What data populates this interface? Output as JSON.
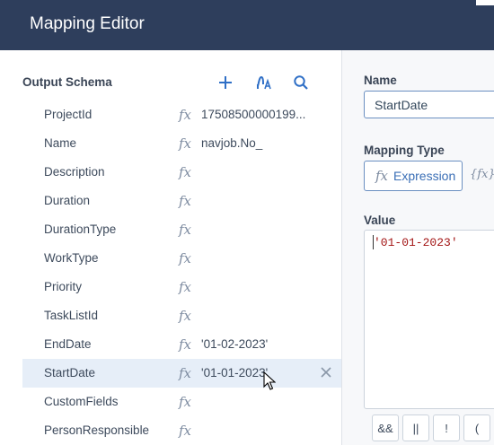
{
  "window": {
    "title": "Mapping Editor"
  },
  "left_panel": {
    "header": "Output Schema",
    "tools": [
      {
        "name": "add-icon",
        "label": "+"
      },
      {
        "name": "sort-icon"
      },
      {
        "name": "search-icon"
      }
    ],
    "rows": [
      {
        "field": "ProjectId",
        "value": "17508500000199..."
      },
      {
        "field": "Name",
        "value": "navjob.No_"
      },
      {
        "field": "Description",
        "value": ""
      },
      {
        "field": "Duration",
        "value": ""
      },
      {
        "field": "DurationType",
        "value": ""
      },
      {
        "field": "WorkType",
        "value": ""
      },
      {
        "field": "Priority",
        "value": ""
      },
      {
        "field": "TaskListId",
        "value": ""
      },
      {
        "field": "EndDate",
        "value": "'01-02-2023'"
      },
      {
        "field": "StartDate",
        "value": "'01-01-2023'",
        "selected": true
      },
      {
        "field": "CustomFields",
        "value": ""
      },
      {
        "field": "PersonResponsible",
        "value": ""
      }
    ],
    "fx_symbol": "fx"
  },
  "right_panel": {
    "name_label": "Name",
    "name_value": "StartDate",
    "mapping_type_label": "Mapping Type",
    "mapping_type_selected": "Expression",
    "mapping_type_icon": "fx",
    "mapping_type_other_icon": "{fx}C",
    "value_label": "Value",
    "value_code": "'01-01-2023'",
    "operators": [
      "&&",
      "||",
      "!",
      "("
    ]
  },
  "colors": {
    "titlebar": "#2e3e5c",
    "accent": "#2f6fc6",
    "selected_row": "#e6eef8",
    "string_literal": "#a31515"
  }
}
